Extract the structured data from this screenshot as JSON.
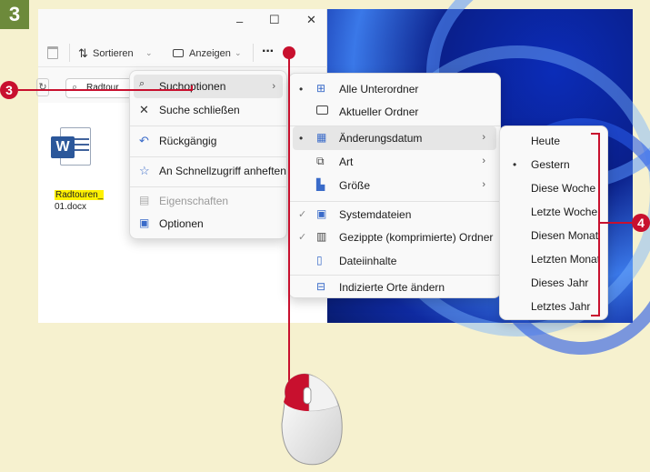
{
  "step_number": "3",
  "callouts": {
    "left": "3",
    "right": "4"
  },
  "window": {
    "minimize": "–",
    "maximize": "☐",
    "close": "✕",
    "more": "···"
  },
  "toolbar": {
    "sort_label": "Sortieren",
    "view_label": "Anzeigen"
  },
  "search": {
    "value": "Radtour"
  },
  "file": {
    "name_line1": "Radtouren_",
    "name_line2": "01.docx",
    "icon_letter": "W"
  },
  "menu1": [
    {
      "label": "Suchoptionen",
      "icon": "search-options-icon",
      "selected": true
    },
    {
      "label": "Suche schließen",
      "icon": "close-icon"
    },
    {
      "label": "Rückgängig",
      "icon": "undo-icon"
    },
    {
      "label": "An Schnellzugriff anheften",
      "icon": "star-icon"
    },
    {
      "label": "Eigenschaften",
      "icon": "properties-icon",
      "disabled": true
    },
    {
      "label": "Optionen",
      "icon": "options-icon"
    }
  ],
  "menu2": [
    {
      "label": "Alle Unterordner",
      "icon": "subfolders-icon",
      "mark": "dot"
    },
    {
      "label": "Aktueller Ordner",
      "icon": "folder-icon"
    },
    {
      "label": "Änderungsdatum",
      "icon": "calendar-icon",
      "mark": "dot",
      "selected": true
    },
    {
      "label": "Art",
      "icon": "type-icon"
    },
    {
      "label": "Größe",
      "icon": "size-icon"
    },
    {
      "label": "Systemdateien",
      "icon": "system-file-icon",
      "mark": "check"
    },
    {
      "label": "Gezippte (komprimierte) Ordner",
      "icon": "zip-folder-icon",
      "mark": "check"
    },
    {
      "label": "Dateiinhalte",
      "icon": "file-contents-icon"
    },
    {
      "label": "Indizierte Orte ändern",
      "icon": "indexed-locations-icon"
    }
  ],
  "menu3": [
    {
      "label": "Heute"
    },
    {
      "label": "Gestern",
      "mark": "dot"
    },
    {
      "label": "Diese Woche"
    },
    {
      "label": "Letzte Woche"
    },
    {
      "label": "Diesen Monat"
    },
    {
      "label": "Letzten Monat"
    },
    {
      "label": "Dieses Jahr"
    },
    {
      "label": "Letztes Jahr"
    }
  ],
  "colors": {
    "accent_red": "#c8102e",
    "badge_green": "#6d8a3b",
    "page_bg": "#f6f1cf"
  }
}
